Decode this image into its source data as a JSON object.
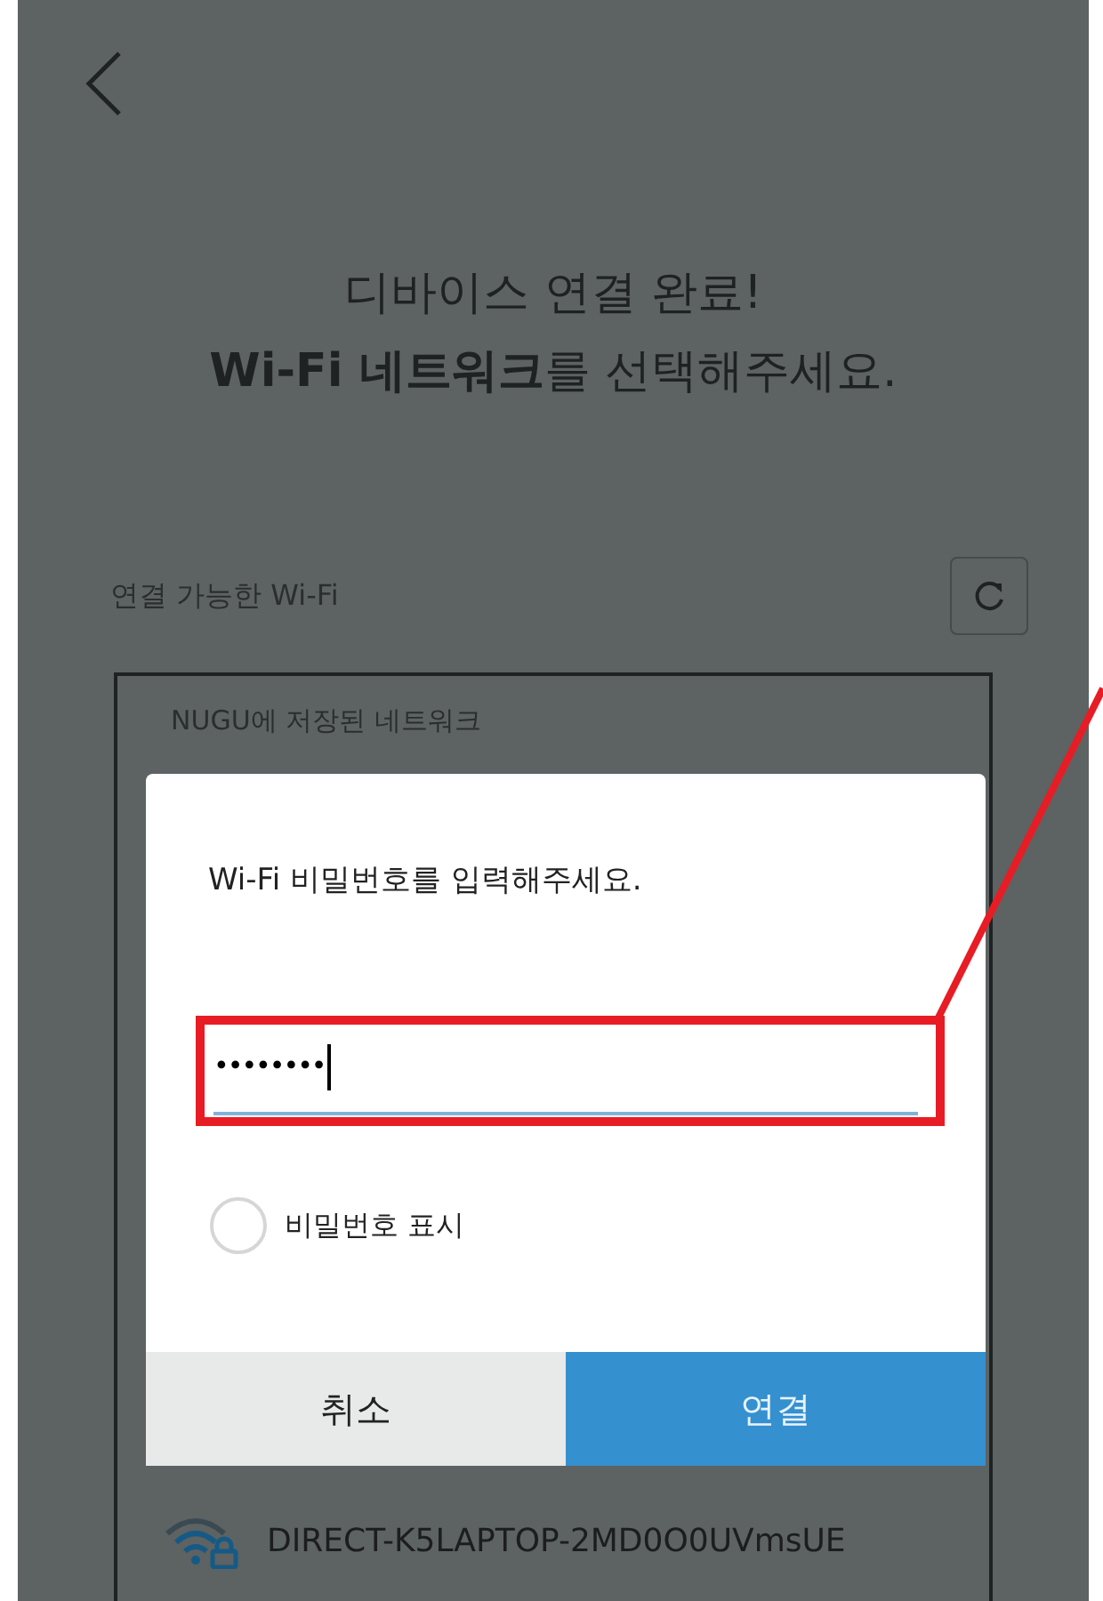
{
  "title": {
    "line_1": "디바이스 연결 완료!",
    "line_2": "**Wi-Fi 네트워크**를 선택해주세요."
  },
  "available": {
    "label": "연결 가능한 Wi-Fi"
  },
  "saved_networks": {
    "heading": "NUGU에 저장된 네트워크"
  },
  "networks": [
    {
      "name": "DIRECT-K5LAPTOP-2MD0O0UVmsUE",
      "locked": true
    }
  ],
  "dialog": {
    "message": "Wi-Fi 비밀번호를 입력해주세요.",
    "password": {
      "value": "••••••••",
      "focused": true
    },
    "show_password": {
      "label": "비밀번호 표시",
      "checked": false
    },
    "buttons": [
      {
        "label": "취소",
        "kind": "cancel"
      },
      {
        "label": "연결",
        "kind": "confirm"
      }
    ]
  }
}
